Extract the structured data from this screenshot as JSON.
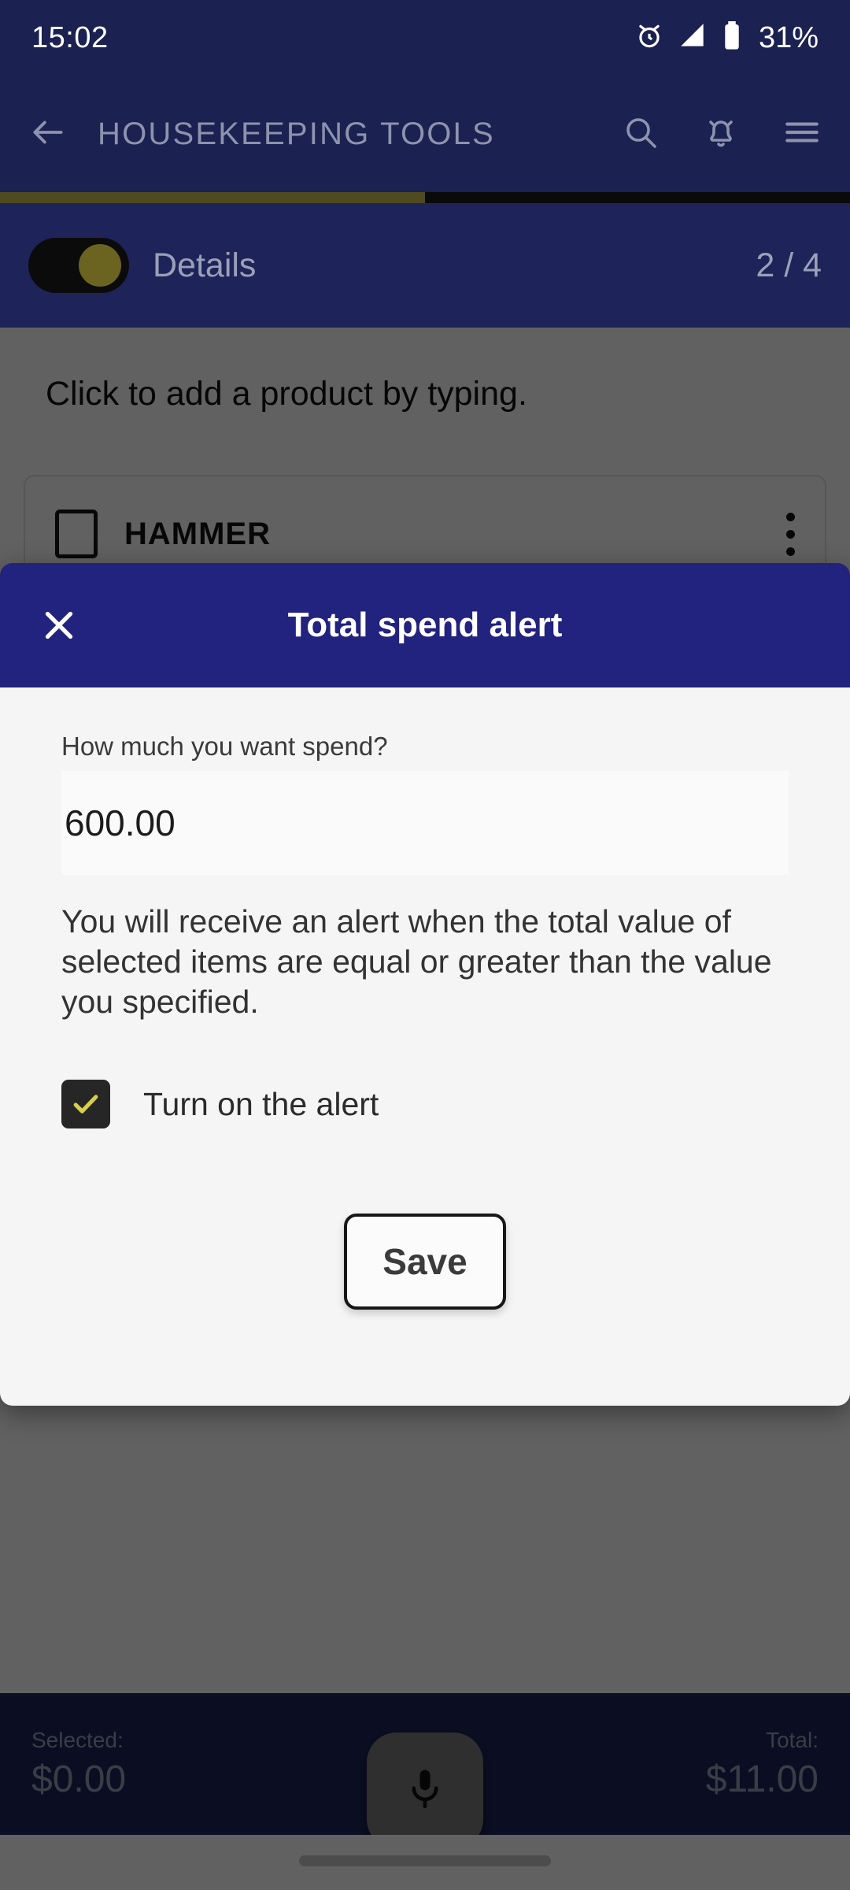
{
  "status_bar": {
    "time": "15:02",
    "battery_percent": "31%",
    "icons": [
      "alarm-clock-icon",
      "signal-icon",
      "battery-icon"
    ]
  },
  "app_bar": {
    "title": "HOUSEKEEPING TOOLS",
    "back_icon": "back-arrow-icon",
    "actions": [
      "search-icon",
      "notification-bell-icon",
      "hamburger-menu-icon"
    ]
  },
  "progress": {
    "percent": 50,
    "fill_color": "#4f4a20",
    "track_color": "#0a0a0a"
  },
  "details_bar": {
    "toggle_on": true,
    "toggle_track_color": "#0b0b0b",
    "toggle_thumb_color": "#6b6420",
    "label": "Details",
    "counter": "2 / 4"
  },
  "content": {
    "add_hint": "Click to add a product by typing.",
    "products": [
      {
        "name": "HAMMER",
        "checked": false,
        "overflow_icon": "kebab-menu-icon"
      }
    ]
  },
  "modal": {
    "title": "Total spend alert",
    "close_icon": "close-icon",
    "header_color": "#22227f",
    "field_label": "How much you want spend?",
    "field_value": "600.00",
    "field_placeholder": "0.00",
    "description": "You will receive an alert when the total value of selected items are equal or greater than the value you specified.",
    "checkbox_label": "Turn on the alert",
    "checkbox_checked": true,
    "checkbox_color": "#262626",
    "check_mark_color": "#d8cf4a",
    "save_label": "Save"
  },
  "bottom_bar": {
    "selected_caption": "Selected:",
    "selected_value": "$0.00",
    "total_caption": "Total:",
    "total_value": "$11.00",
    "mic_icon": "microphone-icon"
  }
}
